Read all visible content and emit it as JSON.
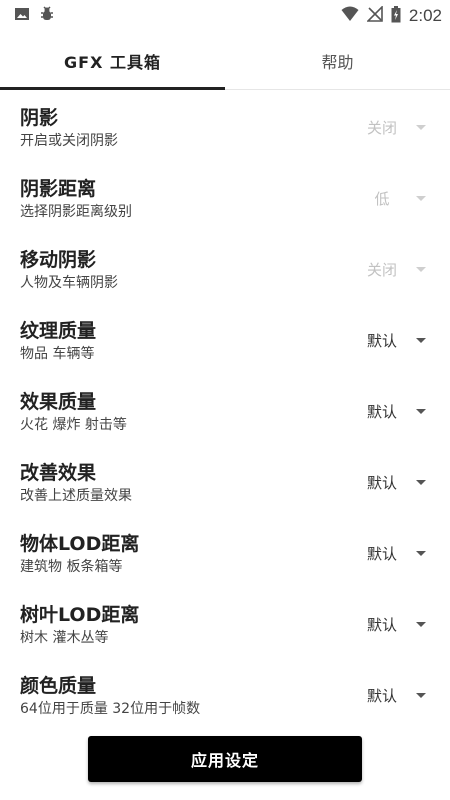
{
  "status_bar": {
    "time": "2:02",
    "icons": [
      "image-icon",
      "bug-icon",
      "wifi-icon",
      "no-signal-icon",
      "battery-icon"
    ]
  },
  "tabs": [
    {
      "label": "GFX 工具箱",
      "active": true
    },
    {
      "label": "帮助",
      "active": false
    }
  ],
  "settings": [
    {
      "title": "阴影",
      "description": "开启或关闭阴影",
      "value": "关闭",
      "enabled": false
    },
    {
      "title": "阴影距离",
      "description": "选择阴影距离级别",
      "value": "低",
      "enabled": false
    },
    {
      "title": "移动阴影",
      "description": "人物及车辆阴影",
      "value": "关闭",
      "enabled": false
    },
    {
      "title": "纹理质量",
      "description": "物品 车辆等",
      "value": "默认",
      "enabled": true
    },
    {
      "title": "效果质量",
      "description": "火花 爆炸 射击等",
      "value": "默认",
      "enabled": true
    },
    {
      "title": "改善效果",
      "description": "改善上述质量效果",
      "value": "默认",
      "enabled": true
    },
    {
      "title": "物体LOD距离",
      "description": "建筑物 板条箱等",
      "value": "默认",
      "enabled": true
    },
    {
      "title": "树叶LOD距离",
      "description": "树木 灌木丛等",
      "value": "默认",
      "enabled": true
    },
    {
      "title": "颜色质量",
      "description": "64位用于质量 32位用于帧数",
      "value": "默认",
      "enabled": true
    }
  ],
  "apply_button": {
    "label": "应用设定"
  },
  "colors": {
    "accent": "#000000",
    "disabled_text": "#c2c2c2",
    "text": "#222222"
  }
}
